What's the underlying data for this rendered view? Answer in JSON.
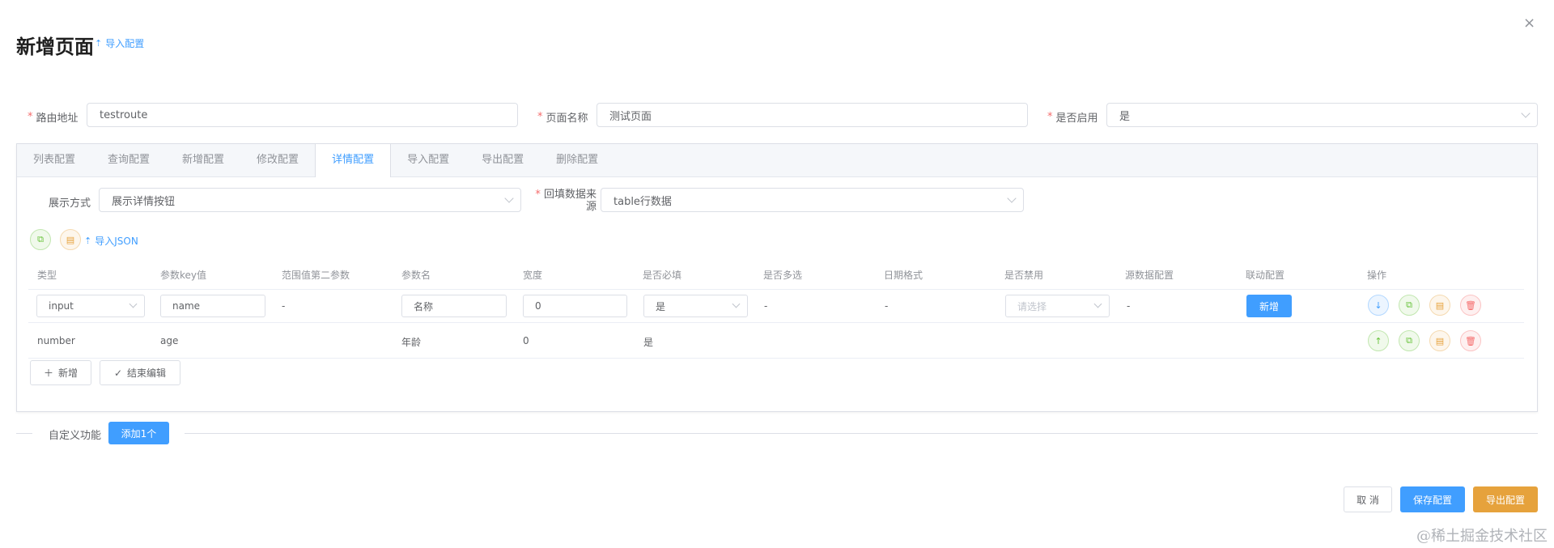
{
  "dialog": {
    "title": "新增页面",
    "import_link": "导入配置",
    "close": "×"
  },
  "form": {
    "route": {
      "label": "路由地址",
      "value": "testroute"
    },
    "page_name": {
      "label": "页面名称",
      "value": "测试页面"
    },
    "enabled": {
      "label": "是否启用",
      "value": "是"
    }
  },
  "tabs": [
    {
      "label": "列表配置"
    },
    {
      "label": "查询配置"
    },
    {
      "label": "新增配置"
    },
    {
      "label": "修改配置"
    },
    {
      "label": "详情配置",
      "active": true
    },
    {
      "label": "导入配置"
    },
    {
      "label": "导出配置"
    },
    {
      "label": "删除配置"
    }
  ],
  "detail": {
    "display_mode": {
      "label": "展示方式",
      "value": "展示详情按钮"
    },
    "data_source": {
      "label_line1": "回填数据来",
      "label_line2": "源",
      "value": "table行数据"
    },
    "import_json": "导入JSON"
  },
  "table": {
    "headers": [
      "类型",
      "参数key值",
      "范围值第二参数",
      "参数名",
      "宽度",
      "是否必填",
      "是否多选",
      "日期格式",
      "是否禁用",
      "源数据配置",
      "联动配置",
      "操作"
    ],
    "row1": {
      "type": "input",
      "key": "name",
      "range": "-",
      "name": "名称",
      "width": "0",
      "required": "是",
      "multi": "-",
      "date_format": "-",
      "disabled_placeholder": "请选择",
      "source": "-",
      "linkage_button": "新增"
    },
    "row2": {
      "type": "number",
      "key": "age",
      "name": "年龄",
      "width": "0",
      "required": "是"
    },
    "add_button": "新增",
    "end_edit_button": "结束编辑"
  },
  "custom": {
    "label": "自定义功能",
    "add_button": "添加1个"
  },
  "footer": {
    "cancel": "取 消",
    "save": "保存配置",
    "export": "导出配置"
  },
  "watermark": "@稀土掘金技术社区",
  "colors": {
    "primary": "#409eff",
    "warning": "#e6a23c",
    "success": "#67c23a",
    "danger": "#f56c6c"
  }
}
